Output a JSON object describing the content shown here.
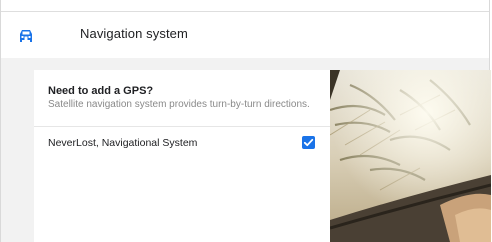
{
  "header": {
    "title": "Navigation system",
    "icon": "car-icon"
  },
  "card": {
    "question": "Need to add a GPS?",
    "description": "Satellite navigation system provides turn-by-turn directions."
  },
  "options": [
    {
      "label": "NeverLost, Navigational System",
      "checked": true
    }
  ],
  "colors": {
    "accent": "#1a73e8",
    "background": "#f2f2f2"
  },
  "image": {
    "icon": "car-interior-photo"
  }
}
